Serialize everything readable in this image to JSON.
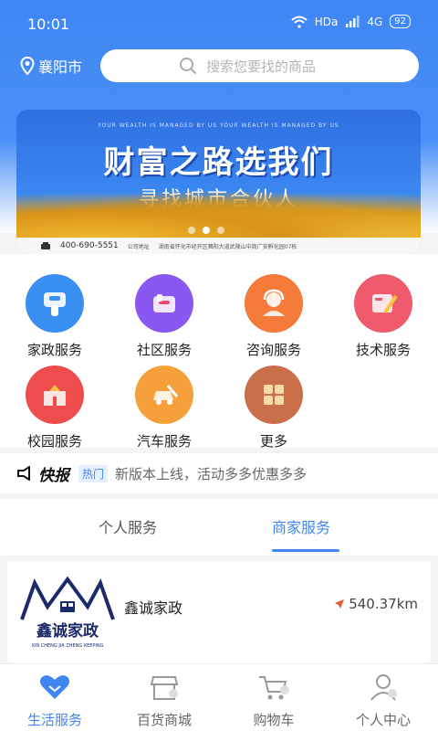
{
  "status": {
    "time": "10:01",
    "net": "HDa",
    "signal": "4G",
    "battery": "92"
  },
  "location": "襄阳市",
  "search": {
    "placeholder": "搜索您要找的商品"
  },
  "banner": {
    "title": "财富之路选我们",
    "subtitle": "寻找城市合伙人",
    "phone": "400-690-5551",
    "address_label": "公司地址",
    "address": "湖南省怀化市经开区舞阳大道武陵山中商广安孵化园07栋",
    "tagline": "YOUR WEALTH IS MANAGED BY US YOUR WEALTH IS MANAGED BY US"
  },
  "services": [
    {
      "label": "家政服务",
      "icon": "housekeeping-icon",
      "color": "#3a8ff2"
    },
    {
      "label": "社区服务",
      "icon": "community-icon",
      "color": "#8a58f0"
    },
    {
      "label": "咨询服务",
      "icon": "consult-icon",
      "color": "#f47b39"
    },
    {
      "label": "技术服务",
      "icon": "tech-icon",
      "color": "#f05a6d"
    },
    {
      "label": "校园服务",
      "icon": "campus-icon",
      "color": "#ef4d4d"
    },
    {
      "label": "汽车服务",
      "icon": "car-icon",
      "color": "#f6a03c"
    },
    {
      "label": "更多",
      "icon": "more-icon",
      "color": "#c9704a"
    }
  ],
  "news": {
    "logo": "快报",
    "tag": "热门",
    "text": "新版本上线，活动多多优惠多多"
  },
  "tabs": [
    {
      "label": "个人服务",
      "active": false
    },
    {
      "label": "商家服务",
      "active": true
    }
  ],
  "merchant": {
    "name": "鑫诚家政",
    "distance": "540.37km",
    "logo_text": "鑫诚家政",
    "logo_sub": "XIN CHENG JIA ZHENG KEEPING"
  },
  "bottom_nav": [
    {
      "label": "生活服务",
      "icon": "heart-icon",
      "active": true
    },
    {
      "label": "百货商城",
      "icon": "store-icon",
      "active": false
    },
    {
      "label": "购物车",
      "icon": "cart-icon",
      "active": false
    },
    {
      "label": "个人中心",
      "icon": "user-icon",
      "active": false
    }
  ],
  "colors": {
    "accent": "#3f86f3"
  }
}
